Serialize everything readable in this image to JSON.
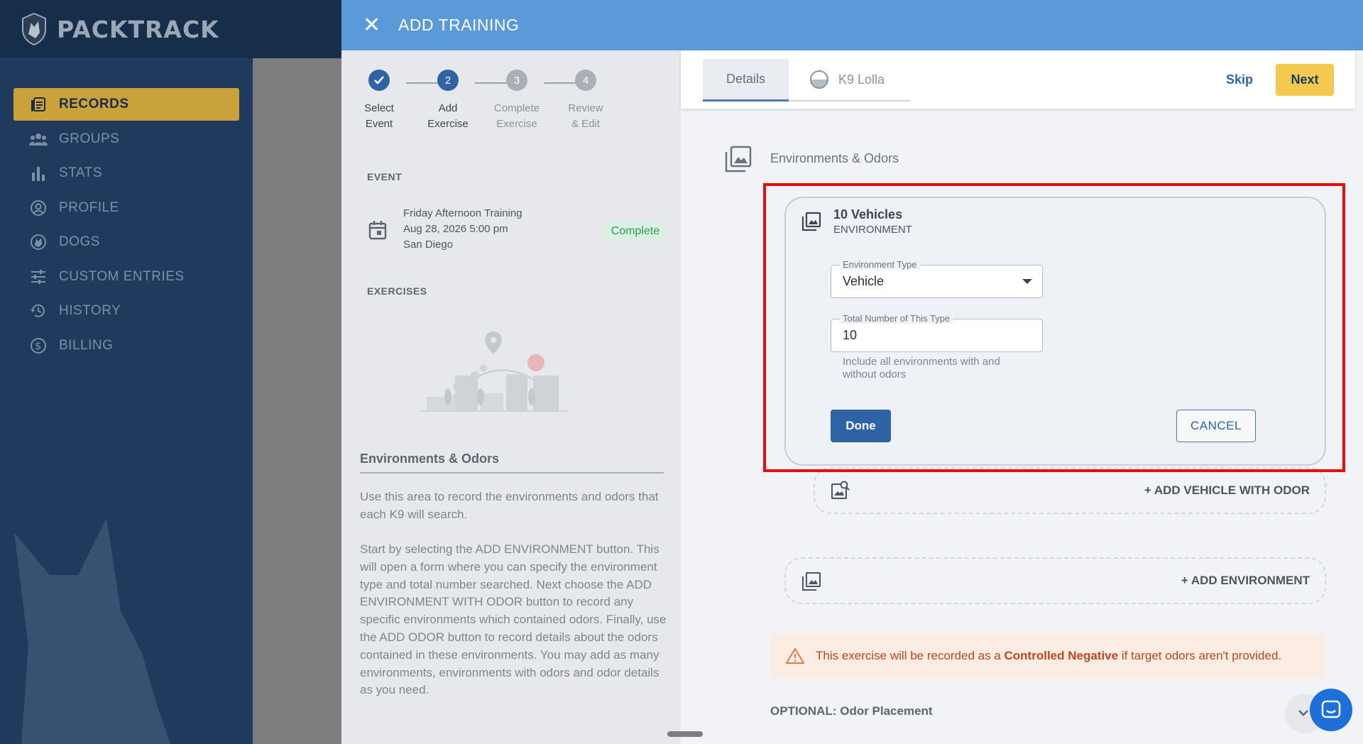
{
  "app": {
    "name": "PACKTRACK"
  },
  "sidebar": {
    "items": [
      {
        "label": "RECORDS",
        "icon": "records-icon"
      },
      {
        "label": "GROUPS",
        "icon": "groups-icon"
      },
      {
        "label": "STATS",
        "icon": "stats-icon"
      },
      {
        "label": "PROFILE",
        "icon": "profile-icon"
      },
      {
        "label": "DOGS",
        "icon": "dogs-icon"
      },
      {
        "label": "CUSTOM ENTRIES",
        "icon": "sliders-icon"
      },
      {
        "label": "HISTORY",
        "icon": "history-icon"
      },
      {
        "label": "BILLING",
        "icon": "dollar-icon"
      }
    ],
    "active_index": 0
  },
  "modal": {
    "title": "ADD TRAINING",
    "close_icon": "close-icon"
  },
  "stepper": {
    "steps": [
      {
        "number": "1",
        "line1": "Select",
        "line2": "Event",
        "state": "done"
      },
      {
        "number": "2",
        "line1": "Add",
        "line2": "Exercise",
        "state": "active"
      },
      {
        "number": "3",
        "line1": "Complete",
        "line2": "Exercise",
        "state": "pending"
      },
      {
        "number": "4",
        "line1": "Review",
        "line2": "& Edit",
        "state": "pending"
      }
    ]
  },
  "event": {
    "section_label": "EVENT",
    "name": "Friday Afternoon Training",
    "datetime": "Aug 28, 2026 5:00 pm",
    "location": "San Diego",
    "status": "Complete"
  },
  "exercises": {
    "section_label": "EXERCISES"
  },
  "help": {
    "heading": "Environments & Odors",
    "para1": "Use this area to record the environments and odors that each K9 will search.",
    "para2": "Start by selecting the ADD ENVIRONMENT button. This will open a form where you can specify the environment type and total number searched. Next choose the ADD ENVIRONMENT WITH ODOR button to record any specific environments which contained odors. Finally, use the ADD ODOR button to record details about the odors contained in these environments. You may add as many environments, environments with odors and odor details as you need."
  },
  "tabs": [
    {
      "label": "Details"
    },
    {
      "label": "K9 Lolla"
    }
  ],
  "actions": {
    "skip": "Skip",
    "next": "Next"
  },
  "env_section": {
    "label": "Environments & Odors"
  },
  "env_card": {
    "title": "10 Vehicles",
    "subtitle": "ENVIRONMENT",
    "type_label": "Environment Type",
    "type_value": "Vehicle",
    "count_label": "Total Number of This Type",
    "count_value": "10",
    "helper": "Include all environments with and without odors",
    "done": "Done",
    "cancel": "CANCEL"
  },
  "add_vehicle_odor": "+ ADD VEHICLE WITH ODOR",
  "add_environment": "+ ADD ENVIRONMENT",
  "warning": {
    "prefix": "This exercise will be recorded as a ",
    "emphasis": "Controlled Negative",
    "suffix": " if target odors aren't provided."
  },
  "optional_label": "OPTIONAL: Odor Placement",
  "colors": {
    "sidebar_bg": "#1f3a5c",
    "active_nav": "#c9a23b",
    "header_blue": "#5a9ad8",
    "primary": "#2e63a6",
    "next_yellow": "#f3c94f",
    "highlight_red": "#e80c0c",
    "success": "#2f9a55",
    "warning": "#c0441c"
  }
}
